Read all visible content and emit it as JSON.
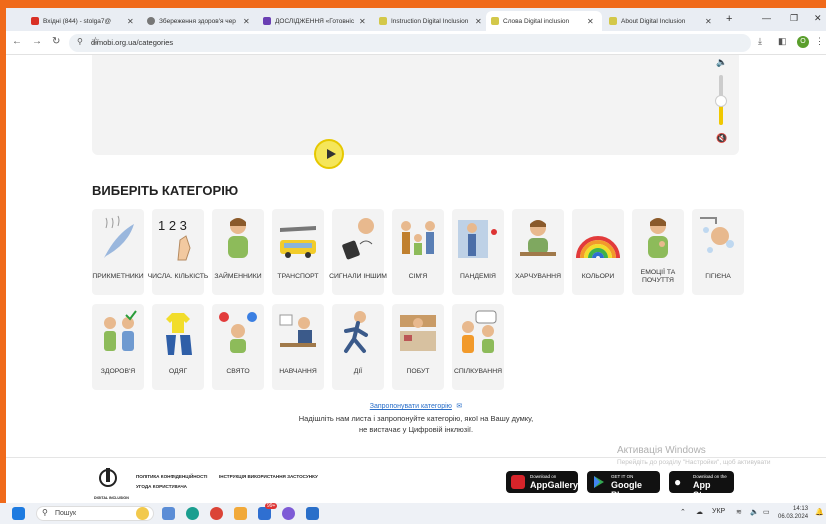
{
  "tabs": [
    {
      "title": "Вхідні (844) - stolga7@",
      "color": "#d93025"
    },
    {
      "title": "Збереження здоров'я чер",
      "color": "#777777"
    },
    {
      "title": "ДОСЛІДЖЕННЯ «Готовніс",
      "color": "#6a3fb3"
    },
    {
      "title": "Instruction Digital Inclusion",
      "color": "#d3c84a"
    },
    {
      "title": "Слова Digital inclusion",
      "color": "#d3c84a"
    },
    {
      "title": "About Digital Inclusion",
      "color": "#d3c84a"
    }
  ],
  "address": {
    "url": "dimobi.org.ua/categories"
  },
  "section_title": "ВИБЕРІТЬ КАТЕГОРІЮ",
  "categories": [
    {
      "label": "ПРИКМЕТНИКИ"
    },
    {
      "label": "ЧИСЛА. КІЛЬКІСТЬ"
    },
    {
      "label": "ЗАЙМЕННИКИ"
    },
    {
      "label": "ТРАНСПОРТ"
    },
    {
      "label": "СИГНАЛИ ІНШИМ"
    },
    {
      "label": "СІМ'Я"
    },
    {
      "label": "ПАНДЕМІЯ"
    },
    {
      "label": "ХАРЧУВАННЯ"
    },
    {
      "label": "КОЛЬОРИ"
    },
    {
      "label": "ЕМОЦІЇ ТА ПОЧУТТЯ"
    },
    {
      "label": "ГІГІЄНА"
    },
    {
      "label": "ЗДОРОВ'Я"
    },
    {
      "label": "ОДЯГ"
    },
    {
      "label": "СВЯТО"
    },
    {
      "label": "НАВЧАННЯ"
    },
    {
      "label": "ДІЇ"
    },
    {
      "label": "ПОБУТ"
    },
    {
      "label": "СПІЛКУВАННЯ"
    }
  ],
  "suggest": {
    "link": "Запропонувати категорію",
    "line1": "Надішліть нам листа і запропонуйте категорію, якої на Вашу думку,",
    "line2": "не вистачає у Цифровій інклюзії."
  },
  "windows_watermark": {
    "title": "Активація Windows",
    "sub": "Перейдіть до розділу \"Настройки\", щоб активувати"
  },
  "footer": {
    "logo_text": "DIGITAL INCLUSION",
    "privacy": "ПОЛІТИКА КОНФІДЕНЦІЙНОСТІ",
    "instruction": "ІНСТРУКЦІЯ ВИКОРИСТАННЯ ЗАСТОСУНКУ",
    "agreement": "УГОДА КОРИСТУВАЧА",
    "stores": [
      {
        "top": "Download on",
        "name": "AppGallery"
      },
      {
        "top": "GET IT ON",
        "name": "Google Play"
      },
      {
        "top": "Download on the",
        "name": "App Store"
      }
    ]
  },
  "taskbar": {
    "search": "Пошук",
    "lang": "УКР",
    "time": "14:13",
    "date": "06.03.2024",
    "mail_badge": "99+"
  }
}
